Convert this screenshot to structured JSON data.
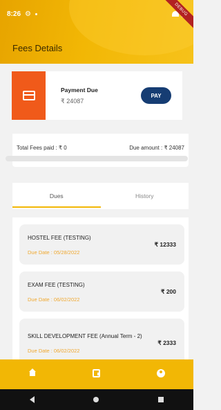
{
  "status": {
    "time": "8:26",
    "debug_label": "DEBUG"
  },
  "header": {
    "title": "Fees Details"
  },
  "payment_card": {
    "label": "Payment Due",
    "amount": "₹ 24087",
    "pay_label": "PAY"
  },
  "summary": {
    "paid_text": "Total Fees paid : ₹ 0",
    "due_text": "Due amount : ₹ 24087",
    "progress_fraction": 0
  },
  "tabs": [
    {
      "label": "Dues",
      "active": true
    },
    {
      "label": "History",
      "active": false
    }
  ],
  "dues": [
    {
      "name": "HOSTEL FEE (TESTING)",
      "date": "Due Date : 05/28/2022",
      "amount": "₹ 12333"
    },
    {
      "name": "EXAM FEE (TESTING)",
      "date": "Due Date : 06/02/2022",
      "amount": "₹ 200"
    },
    {
      "name": "SKILL DEVELOPMENT FEE (Annual Term - 2)",
      "date": "Due Date : 06/02/2022",
      "amount": "₹ 2333"
    }
  ],
  "bottom_nav": {
    "items": [
      {
        "icon": "home-icon"
      },
      {
        "icon": "receipt-icon"
      },
      {
        "icon": "profile-icon"
      }
    ]
  },
  "colors": {
    "accent": "#f2b705",
    "pay_button": "#163d73",
    "wallet_tile": "#f05a1a",
    "due_date": "#f0a830"
  }
}
